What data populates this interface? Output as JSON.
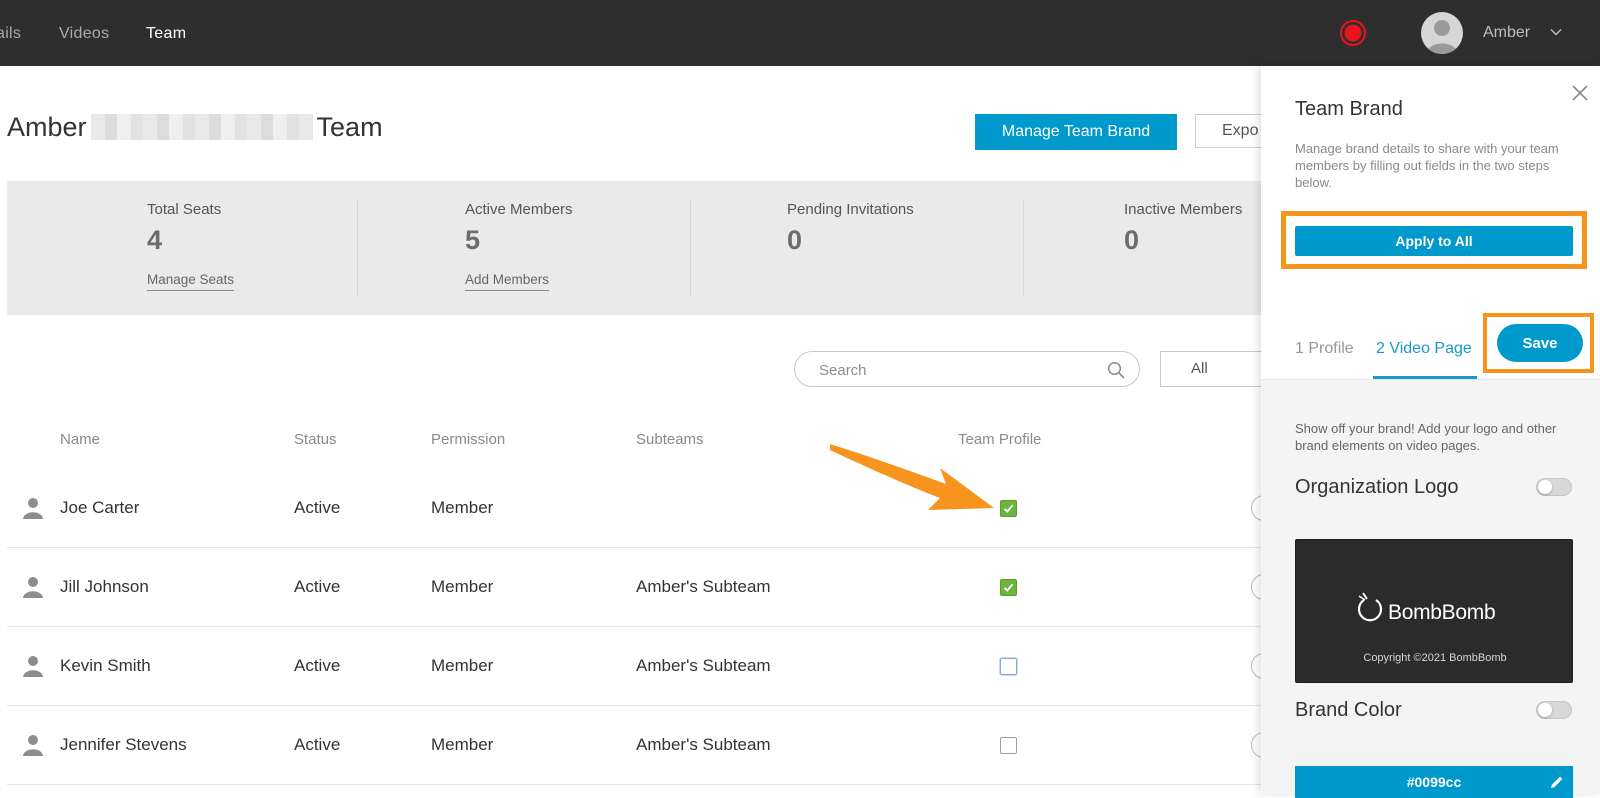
{
  "nav": {
    "items": [
      {
        "label": "ails"
      },
      {
        "label": "Videos"
      },
      {
        "label": "Team"
      }
    ],
    "user_name": "Amber"
  },
  "page": {
    "title_prefix": "Amber",
    "title_suffix": "Team",
    "manage_brand_label": "Manage Team Brand",
    "export_label": "Expo"
  },
  "stats": [
    {
      "label": "Total Seats",
      "value": "4",
      "link": "Manage Seats"
    },
    {
      "label": "Active Members",
      "value": "5",
      "link": "Add Members"
    },
    {
      "label": "Pending Invitations",
      "value": "0"
    },
    {
      "label": "Inactive Members",
      "value": "0"
    }
  ],
  "search": {
    "placeholder": "Search"
  },
  "filter": {
    "selected": "All"
  },
  "table": {
    "headers": [
      "Name",
      "Status",
      "Permission",
      "Subteams",
      "Team Profile"
    ],
    "rows": [
      {
        "name": "Joe Carter",
        "status": "Active",
        "permission": "Member",
        "subteam": "",
        "team_profile": true
      },
      {
        "name": "Jill Johnson",
        "status": "Active",
        "permission": "Member",
        "subteam": "Amber's Subteam",
        "team_profile": true
      },
      {
        "name": "Kevin Smith",
        "status": "Active",
        "permission": "Member",
        "subteam": "Amber's Subteam",
        "team_profile": false
      },
      {
        "name": "Jennifer Stevens",
        "status": "Active",
        "permission": "Member",
        "subteam": "Amber's Subteam",
        "team_profile": false
      }
    ]
  },
  "panel": {
    "title": "Team Brand",
    "description": "Manage brand details to share with your team members by filling out fields in the two steps below.",
    "apply_label": "Apply to All",
    "tabs": [
      {
        "label": "1 Profile"
      },
      {
        "label": "2 Video Page"
      }
    ],
    "save_label": "Save",
    "video_page_desc": "Show off your brand! Add your logo and other brand elements on video pages.",
    "org_logo_title": "Organization Logo",
    "logo_brand_text": "BombBomb",
    "logo_copyright": "Copyright ©2021 BombBomb",
    "brand_color_title": "Brand Color",
    "brand_color_value": "#0099cc"
  },
  "colors": {
    "accent": "#0099cc",
    "highlight": "#f7941d",
    "checked": "#6cb33f",
    "topbar": "#2e2e2f"
  }
}
